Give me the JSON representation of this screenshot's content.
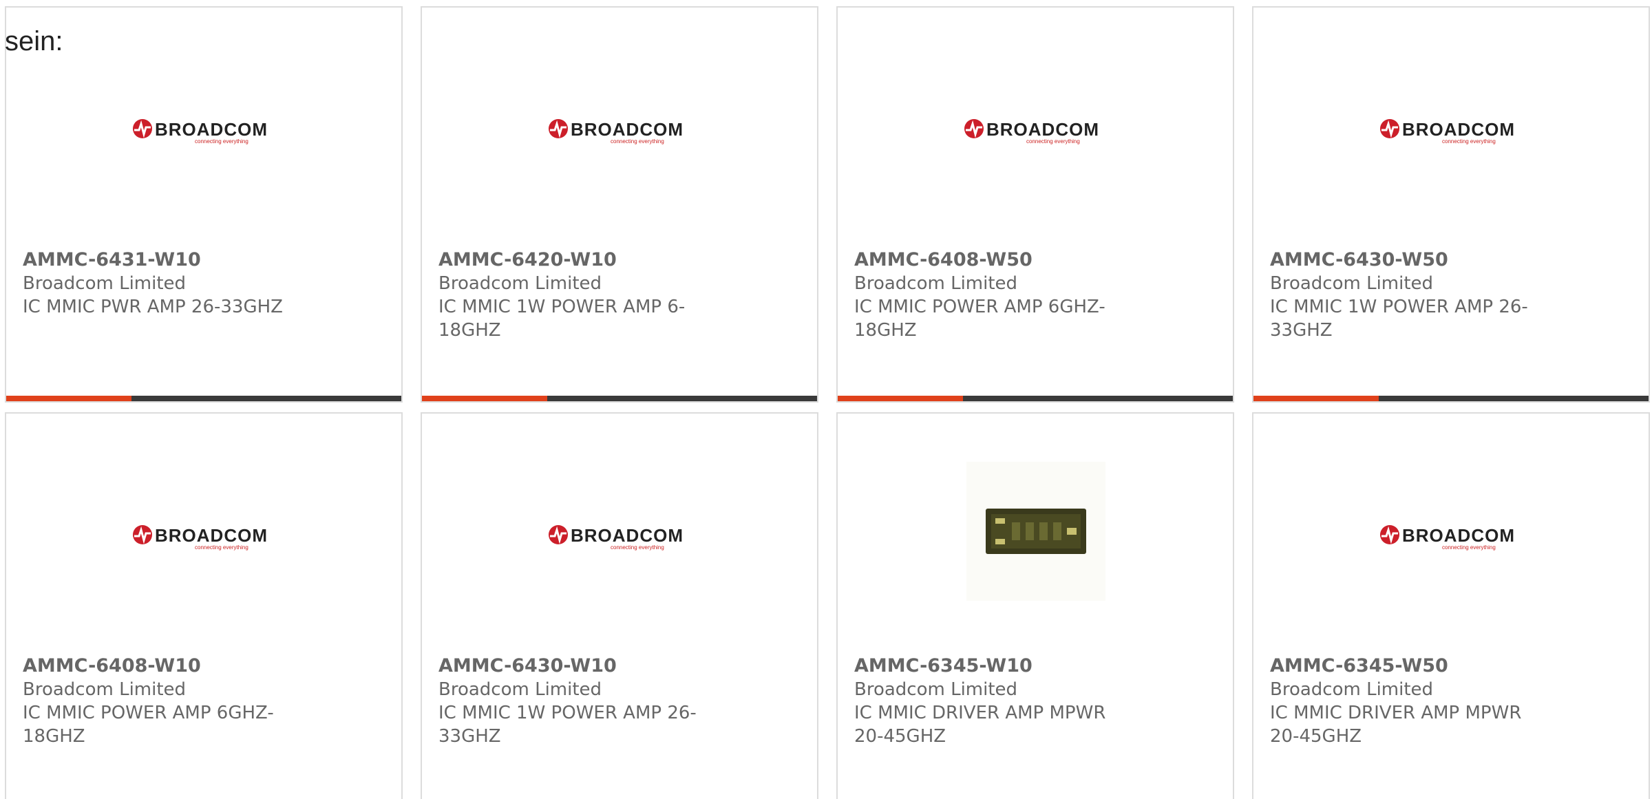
{
  "intro_text": "sein:",
  "colors": {
    "accent": "#e0411b",
    "bar_dark": "#3a3a3a",
    "logo_red": "#cc1f2a"
  },
  "logo": {
    "name": "BROADCOM",
    "tagline": "connecting everything"
  },
  "products": [
    {
      "part": "AMMC-6431-W10",
      "manufacturer": "Broadcom Limited",
      "description": "IC MMIC PWR AMP 26-33GHZ",
      "image": "broadcom-logo"
    },
    {
      "part": "AMMC-6420-W10",
      "manufacturer": "Broadcom Limited",
      "description": "IC MMIC 1W POWER AMP 6-18GHZ",
      "image": "broadcom-logo"
    },
    {
      "part": "AMMC-6408-W50",
      "manufacturer": "Broadcom Limited",
      "description": "IC MMIC POWER AMP 6GHZ-18GHZ",
      "image": "broadcom-logo"
    },
    {
      "part": "AMMC-6430-W50",
      "manufacturer": "Broadcom Limited",
      "description": "IC MMIC 1W POWER AMP 26-33GHZ",
      "image": "broadcom-logo"
    },
    {
      "part": "AMMC-6408-W10",
      "manufacturer": "Broadcom Limited",
      "description": "IC MMIC POWER AMP 6GHZ-18GHZ",
      "image": "broadcom-logo"
    },
    {
      "part": "AMMC-6430-W10",
      "manufacturer": "Broadcom Limited",
      "description": "IC MMIC 1W POWER AMP 26-33GHZ",
      "image": "broadcom-logo"
    },
    {
      "part": "AMMC-6345-W10",
      "manufacturer": "Broadcom Limited",
      "description": "IC MMIC DRIVER AMP MPWR 20-45GHZ",
      "image": "chip-photo"
    },
    {
      "part": "AMMC-6345-W50",
      "manufacturer": "Broadcom Limited",
      "description": "IC MMIC DRIVER AMP MPWR 20-45GHZ",
      "image": "broadcom-logo"
    }
  ]
}
